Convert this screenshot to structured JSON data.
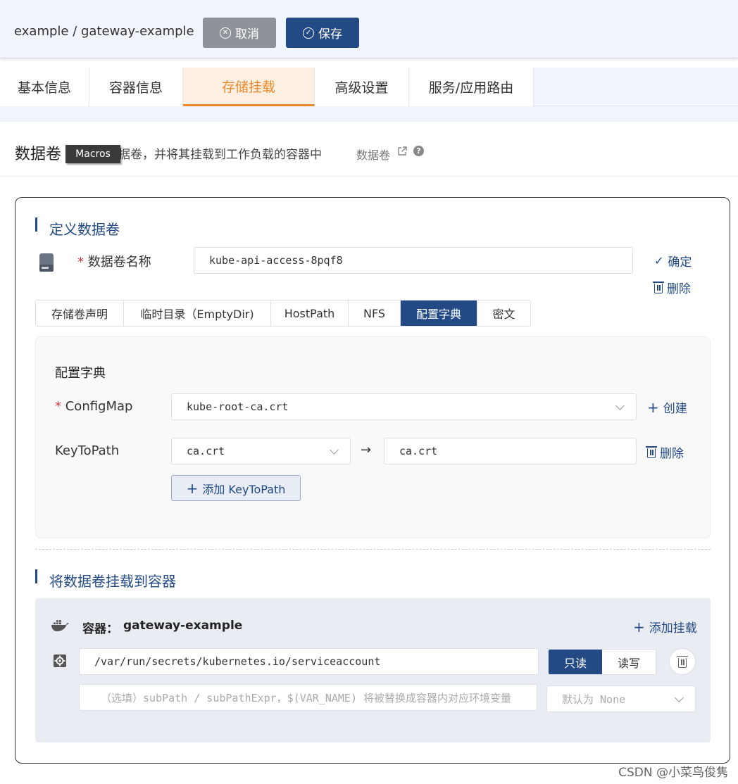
{
  "header": {
    "breadcrumb": "example / gateway-example",
    "cancel_label": "取消",
    "save_label": "保存"
  },
  "tabs": [
    "基本信息",
    "容器信息",
    "存储挂载",
    "高级设置",
    "服务/应用路由"
  ],
  "active_tab": "存储挂载",
  "hint": {
    "title": "数据卷",
    "description": "据卷，并将其挂载到工作负载的容器中",
    "link": "数据卷",
    "tooltip": "Macros"
  },
  "define": {
    "section_title": "定义数据卷",
    "name_label": "数据卷名称",
    "name_value": "kube-api-access-8pqf8",
    "confirm_label": "确定",
    "delete_label": "删除",
    "volume_types": [
      "存储卷声明",
      "临时目录（EmptyDir)",
      "HostPath",
      "NFS",
      "配置字典",
      "密文"
    ],
    "active_type": "配置字典",
    "config": {
      "panel_title": "配置字典",
      "configmap_label": "ConfigMap",
      "configmap_value": "kube-root-ca.crt",
      "create_label": "创建",
      "keytopath_label": "KeyToPath",
      "key_value": "ca.crt",
      "arrow": "→",
      "path_value": "ca.crt",
      "delete_label": "删除",
      "add_keytopath_label": "添加 KeyToPath"
    }
  },
  "mount": {
    "section_title": "将数据卷挂载到容器",
    "container_label": "容器：",
    "container_name": "gateway-example",
    "add_mount_label": "添加挂载",
    "mount_path": "/var/run/secrets/kubernetes.io/serviceaccount",
    "readonly_label": "只读",
    "readwrite_label": "读写",
    "active_mode": "只读",
    "subpath_placeholder": "（选填）subPath / subPathExpr，$(VAR_NAME) 将被替换成容器内对应环境变量",
    "default_placeholder": "默认为 None"
  },
  "watermark": "CSDN @小菜鸟俊隽",
  "colors": {
    "primary": "#234a84",
    "accent": "#e9892a",
    "required": "#d9363e"
  }
}
